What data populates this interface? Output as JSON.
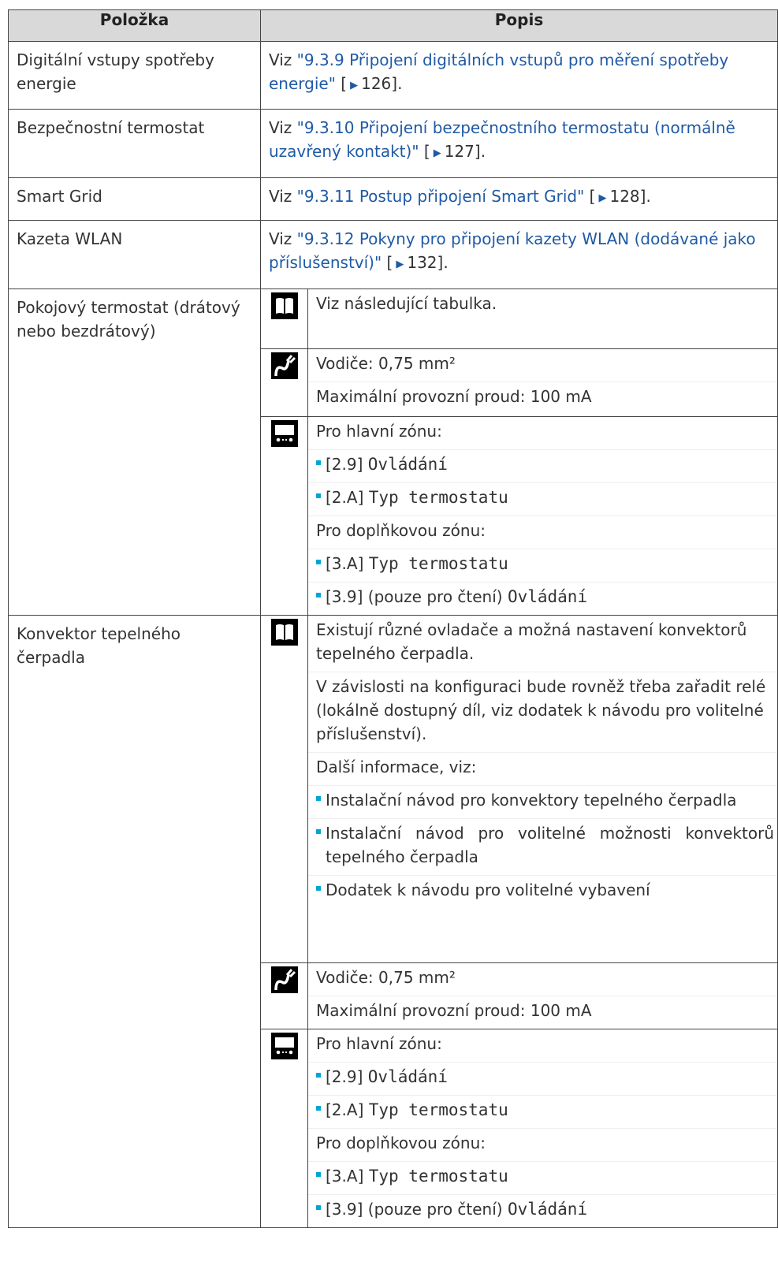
{
  "table": {
    "header_item": "Položka",
    "header_desc": "Popis",
    "viz": "Viz",
    "rows": [
      {
        "item": "Digitální vstupy spotřeby energie",
        "link": "\"9.3.9 Připojení digitálních vstupů pro měření spotřeby energie\"",
        "page": "126"
      },
      {
        "item": "Bezpečnostní termostat",
        "link": "\"9.3.10 Připojení bezpečnostního termostatu (normálně uzavřený kontakt)\"",
        "page": "127"
      },
      {
        "item": "Smart Grid",
        "link": "\"9.3.11 Postup připojení Smart Grid\"",
        "page": "128"
      },
      {
        "item": "Kazeta WLAN",
        "link": "\"9.3.12 Pokyny pro připojení kazety WLAN (dodávané jako příslušenství)\"",
        "page": "132"
      }
    ]
  },
  "thermostat": {
    "item": "Pokojový termostat (drátový nebo bezdrátový)",
    "book_text": "Viz následující tabulka.",
    "wire_text": "Vodiče: 0,75 mm²",
    "current_text": "Maximální provozní proud: 100 mA",
    "main_zone": "Pro hlavní zónu:",
    "b1_code": "[2.9]",
    "b1_name": "Ovládání",
    "b2_code": "[2.A]",
    "b2_name": "Typ termostatu",
    "extra_zone": "Pro doplňkovou zónu:",
    "b3_code": "[3.A]",
    "b3_name": "Typ termostatu",
    "b4_code": "[3.9] (pouze pro čtení)",
    "b4_name": "Ovládání"
  },
  "convector": {
    "item": "Konvektor tepelného čerpadla",
    "book_p1": "Existují různé ovladače a možná nastavení konvektorů tepelného čerpadla.",
    "book_p2": "V závislosti na konfiguraci bude rovněž třeba zařadit relé (lokálně dostupný díl, viz dodatek k návodu pro volitelné příslušenství).",
    "book_p3": "Další informace, viz:",
    "book_b1": "Instalační návod pro konvektory tepelného čerpadla",
    "book_b2": "Instalační návod pro volitelné možnosti konvektorů tepelného čerpadla",
    "book_b3": "Dodatek k návodu pro volitelné vybavení",
    "wire_text": "Vodiče: 0,75 mm²",
    "current_text": "Maximální provozní proud: 100 mA",
    "main_zone": "Pro hlavní zónu:",
    "b1_code": "[2.9]",
    "b1_name": "Ovládání",
    "b2_code": "[2.A]",
    "b2_name": "Typ termostatu",
    "extra_zone": "Pro doplňkovou zónu:",
    "b3_code": "[3.A]",
    "b3_name": "Typ termostatu",
    "b4_code": "[3.9] (pouze pro čtení)",
    "b4_name": "Ovládání"
  },
  "icons": {
    "book": "book-icon",
    "wire": "wire-icon",
    "controller": "controller-icon"
  },
  "colors": {
    "link": "#1f5aa6",
    "bullet": "#00a5d8",
    "header_bg": "#d9d9d9"
  }
}
